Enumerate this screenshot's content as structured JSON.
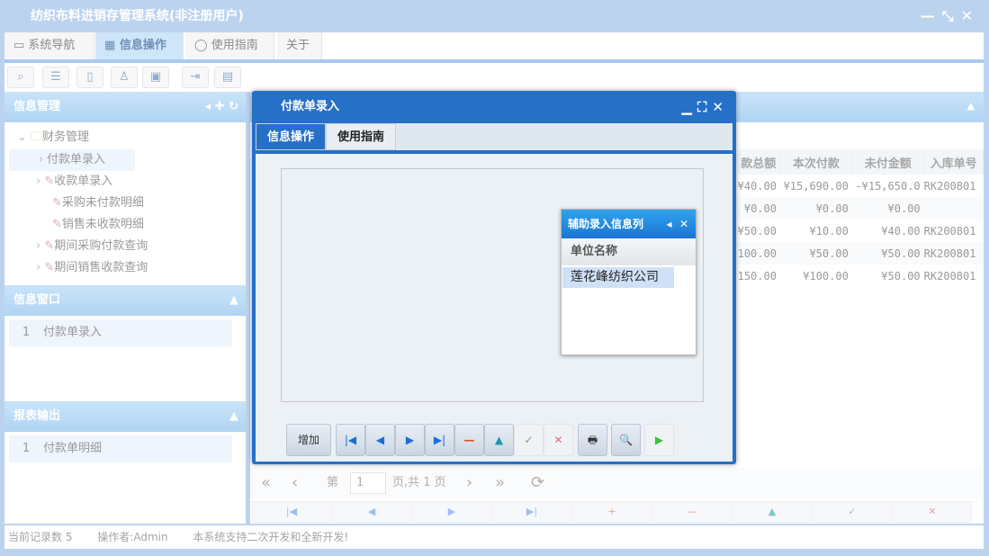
{
  "app": {
    "title": "纺织布料进销存管理系统(非注册用户)",
    "window_controls": [
      "—",
      "⤡",
      "✕"
    ]
  },
  "main_tabs": [
    {
      "label": "系统导航",
      "icon": "monitor-icon"
    },
    {
      "label": "信息操作",
      "icon": "grid-icon",
      "active": true
    },
    {
      "label": "使用指南",
      "icon": "help-icon"
    },
    {
      "label": "关于"
    }
  ],
  "toolbar_icons": [
    "search-doc-icon",
    "list-icon",
    "document-icon",
    "user-chart-icon",
    "monitor-color-icon",
    "export-icon",
    "window-icon"
  ],
  "sidebar": {
    "panel1": {
      "title": "信息管理",
      "root": "财务管理",
      "items": [
        {
          "label": "付款单录入",
          "expand": true,
          "selected": true
        },
        {
          "label": "收款单录入",
          "expand": true
        },
        {
          "label": "采购未付款明细",
          "expand": false
        },
        {
          "label": "销售未收款明细",
          "expand": false
        },
        {
          "label": "期间采购付款查询",
          "expand": true
        },
        {
          "label": "期间销售收款查询",
          "expand": true
        }
      ]
    },
    "panel2": {
      "title": "信息窗口",
      "rows": [
        {
          "num": "1",
          "label": "付款单录入"
        }
      ]
    },
    "panel3": {
      "title": "报表输出",
      "rows": [
        {
          "num": "1",
          "label": "付款单明细"
        }
      ]
    }
  },
  "grid": {
    "columns": [
      "款总额",
      "本次付款",
      "未付金额",
      "入库单号"
    ],
    "rows": [
      [
        "¥40.00",
        "¥15,690.00",
        "-¥15,650.0",
        "RK200801"
      ],
      [
        "¥0.00",
        "¥0.00",
        "¥0.00",
        ""
      ],
      [
        "¥50.00",
        "¥10.00",
        "¥40.00",
        "RK200801"
      ],
      [
        "100.00",
        "¥50.00",
        "¥50.00",
        "RK200801"
      ],
      [
        "150.00",
        "¥100.00",
        "¥50.00",
        "RK200801"
      ]
    ]
  },
  "pager": {
    "first": "«",
    "prev": "‹",
    "page_label": "第",
    "page_value": "1",
    "total": "页,共 1 页",
    "next": "›",
    "last": "»",
    "refresh": "⟳"
  },
  "bottom_buttons": [
    "|◀",
    "◀",
    "▶",
    "▶|",
    "+",
    "—",
    "▲",
    "✓",
    "✕"
  ],
  "status": {
    "records": "当前记录数 5",
    "operator": "操作者:Admin",
    "note": "本系统支持二次开发和全新开发!"
  },
  "modal": {
    "title": "付款单录入",
    "tabs": [
      "信息操作",
      "使用指南"
    ],
    "helper": {
      "title": "辅助录入信息列",
      "column": "单位名称",
      "rows": [
        "莲花峰纺织公司"
      ]
    },
    "buttons": {
      "add": "增加",
      "first": "|◀",
      "prev": "◀",
      "next": "▶",
      "last": "▶|",
      "delete": "—",
      "up": "▲",
      "ok": "✓",
      "cancel": "✕",
      "print": "🖶",
      "preview": "🔍",
      "run": "▶"
    }
  }
}
